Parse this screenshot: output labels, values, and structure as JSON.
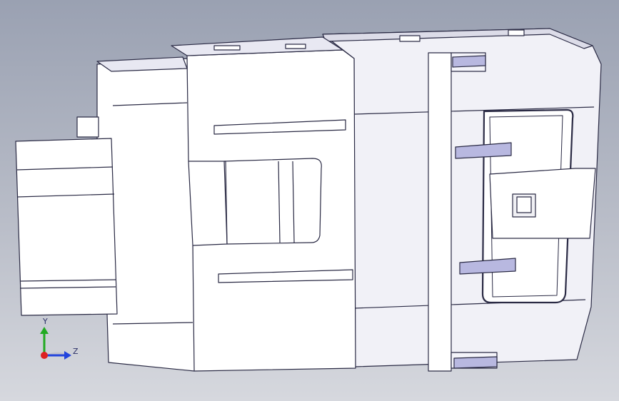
{
  "viewport": {
    "background_top": "#9aa1b2",
    "background_bottom": "#d6d8de"
  },
  "model": {
    "part_fill": "#ffffff",
    "part_shade": "#e6e6f0",
    "edge_color": "#2a2a44",
    "accent_fill": "#b8b8e0"
  },
  "triad": {
    "y_label": "Y",
    "z_label": "Z",
    "y_color": "#22aa22",
    "z_color": "#2244dd",
    "origin_color": "#dd2222"
  }
}
